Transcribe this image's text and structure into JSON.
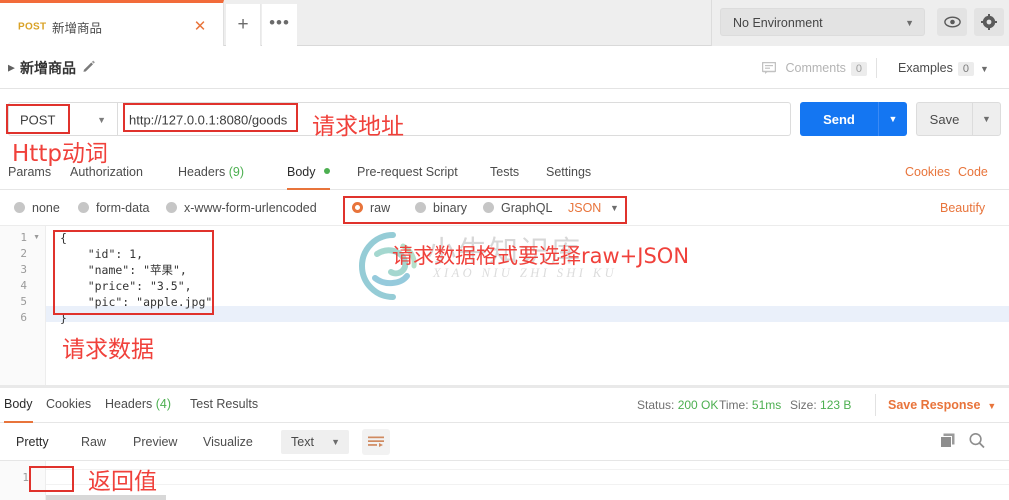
{
  "tabbar": {
    "tab": {
      "method": "POST",
      "title": "新增商品",
      "close": "✕"
    },
    "add": "+",
    "more": "•••",
    "environment": {
      "label": "No Environment",
      "caret": "▼"
    },
    "eye_icon": "eye-icon",
    "gear_icon": "gear-icon"
  },
  "breadcrumb": {
    "arrow": "▶",
    "name": "新增商品",
    "edit_icon": "pencil-icon",
    "comments_label": "Comments",
    "comments_count": "0",
    "examples_label": "Examples",
    "examples_count": "0",
    "examples_caret": "▼"
  },
  "urlbar": {
    "method": "POST",
    "method_caret": "▼",
    "url": "http://127.0.0.1:8080/goods",
    "send_label": "Send",
    "send_caret": "▼",
    "save_label": "Save",
    "save_caret": "▼"
  },
  "request_tabs": [
    {
      "label": "Params",
      "count": "",
      "active": false,
      "dot": false
    },
    {
      "label": "Authorization",
      "count": "",
      "active": false,
      "dot": false
    },
    {
      "label": "Headers",
      "count": "(9)",
      "active": false,
      "dot": false
    },
    {
      "label": "Body",
      "count": "",
      "active": true,
      "dot": true
    },
    {
      "label": "Pre-request Script",
      "count": "",
      "active": false,
      "dot": false
    },
    {
      "label": "Tests",
      "count": "",
      "active": false,
      "dot": false
    },
    {
      "label": "Settings",
      "count": "",
      "active": false,
      "dot": false
    }
  ],
  "request_links": {
    "cookies": "Cookies",
    "code": "Code"
  },
  "body_types": [
    {
      "label": "none",
      "selected": false
    },
    {
      "label": "form-data",
      "selected": false
    },
    {
      "label": "x-www-form-urlencoded",
      "selected": false
    },
    {
      "label": "raw",
      "selected": true
    },
    {
      "label": "binary",
      "selected": false
    },
    {
      "label": "GraphQL",
      "selected": false
    }
  ],
  "body_format": {
    "label": "JSON",
    "caret": "▼"
  },
  "beautify": "Beautify",
  "editor": {
    "lines": [
      {
        "num": "1",
        "fold": "▼",
        "text": "{"
      },
      {
        "num": "2",
        "fold": "",
        "text": "    \"id\": 1,"
      },
      {
        "num": "3",
        "fold": "",
        "text": "    \"name\": \"苹果\","
      },
      {
        "num": "4",
        "fold": "",
        "text": "    \"price\": \"3.5\","
      },
      {
        "num": "5",
        "fold": "",
        "text": "    \"pic\": \"apple.jpg\""
      },
      {
        "num": "6",
        "fold": "",
        "text": "}"
      }
    ]
  },
  "watermark": {
    "cn": "小牛知识库",
    "en": "XIAO NIU ZHI SHI KU"
  },
  "response_tabs": [
    {
      "label": "Body",
      "count": "",
      "active": true
    },
    {
      "label": "Cookies",
      "count": "",
      "active": false
    },
    {
      "label": "Headers",
      "count": "(4)",
      "active": false
    },
    {
      "label": "Test Results",
      "count": "",
      "active": false
    }
  ],
  "response_meta": {
    "status_label": "Status:",
    "status_value": "200 OK",
    "time_label": "Time:",
    "time_value": "51ms",
    "size_label": "Size:",
    "size_value": "123 B",
    "save_response": "Save Response",
    "save_caret": "▼"
  },
  "response_view_tabs": [
    {
      "label": "Pretty",
      "active": true
    },
    {
      "label": "Raw",
      "active": false
    },
    {
      "label": "Preview",
      "active": false
    },
    {
      "label": "Visualize",
      "active": false
    }
  ],
  "response_format": {
    "label": "Text",
    "caret": "▼"
  },
  "response_wrap_icon": "word-wrap-icon",
  "response_copy_icon": "copy-icon",
  "response_search_icon": "search-icon",
  "response_body": {
    "line_num": "1",
    "text": ""
  },
  "annotations": {
    "http_verb": "Http动词",
    "request_url": "请求地址",
    "body_format_note": "请求数据格式要选择raw+JSON",
    "request_data": "请求数据",
    "return_value": "返回值"
  },
  "colors": {
    "accent_orange": "#e8743b",
    "send_blue": "#1476f2",
    "annotation_red": "#f0413b",
    "status_green": "#4caf50",
    "method_yellow": "#d9a227"
  }
}
